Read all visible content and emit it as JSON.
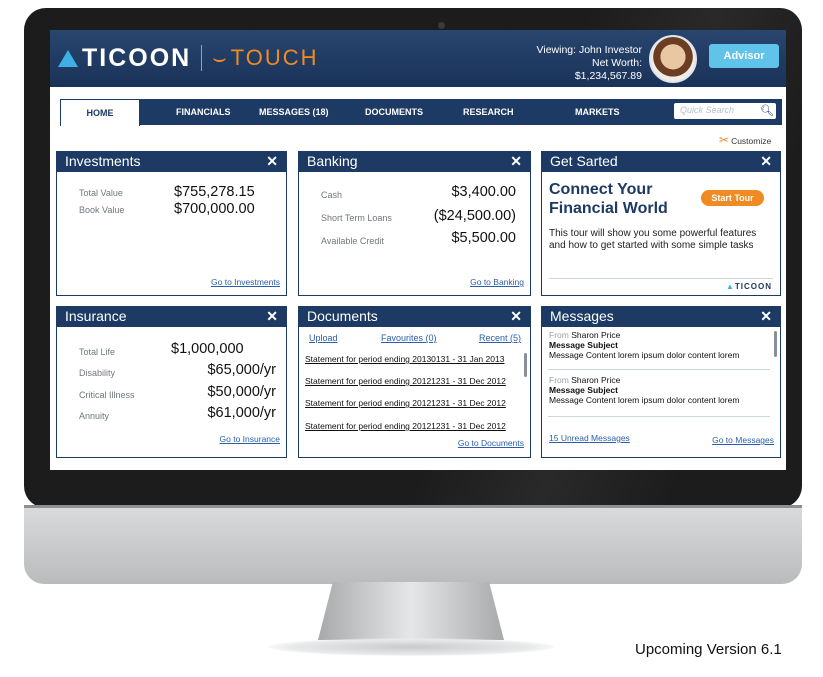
{
  "brand": {
    "logo_name": "TICOON",
    "logo_touch": "TOUCH"
  },
  "header": {
    "viewing": "Viewing: John Investor",
    "net_worth": "Net Worth: $1,234,567.89",
    "advisor_label": "Advisor"
  },
  "nav": {
    "items": [
      {
        "label": "HOME"
      },
      {
        "label": "FINANCIALS"
      },
      {
        "label": "MESSAGES (18)"
      },
      {
        "label": "DOCUMENTS"
      },
      {
        "label": "RESEARCH"
      },
      {
        "label": "MARKETS"
      }
    ],
    "active": "HOME",
    "search_placeholder": "Quick Search",
    "customize_label": "Customize"
  },
  "investments": {
    "title": "Investments",
    "rows": [
      {
        "label": "Total Value",
        "value": "$755,278.15"
      },
      {
        "label": "Book Value",
        "value": "$700,000.00"
      }
    ],
    "link": "Go to Investments"
  },
  "banking": {
    "title": "Banking",
    "rows": [
      {
        "label": "Cash",
        "value": "$3,400.00"
      },
      {
        "label": "Short Term Loans",
        "value": "($24,500.00)"
      },
      {
        "label": "Available Credit",
        "value": "$5,500.00"
      }
    ],
    "link": "Go to Banking"
  },
  "get_started": {
    "title": "Get Sarted",
    "heading_line1": "Connect Your",
    "heading_line2": "Financial World",
    "button": "Start Tour",
    "text": "This tour will show you some powerful features and how to get started with some simple tasks",
    "footer_logo": "TICOON"
  },
  "insurance": {
    "title": "Insurance",
    "rows": [
      {
        "label": "Total Life",
        "value": "$1,000,000"
      },
      {
        "label": "Disability",
        "value": "$65,000/yr"
      },
      {
        "label": "Critical Illness",
        "value": "$50,000/yr"
      },
      {
        "label": "Annuity",
        "value": "$61,000/yr"
      }
    ],
    "link": "Go to Insurance"
  },
  "documents": {
    "title": "Documents",
    "tabs": [
      "Upload",
      "Favourites (0)",
      "Recent (5)"
    ],
    "items": [
      "Statement for period ending 20130131 - 31 Jan 2013",
      "Statement for period ending 20121231 - 31 Dec 2012",
      "Statement for period ending 20121231 - 31 Dec 2012",
      "Statement for period ending 20121231 - 31 Dec 2012"
    ],
    "link": "Go to Documents"
  },
  "messages": {
    "title": "Messages",
    "items": [
      {
        "from_prefix": "From",
        "from": "Sharon Price",
        "subject": "Message Subject",
        "body": "Message Content lorem ipsum dolor content lorem"
      },
      {
        "from_prefix": "From",
        "from": "Sharon Price",
        "subject": "Message Subject",
        "body": "Message Content lorem ipsum dolor content lorem"
      }
    ],
    "unread_link": "15 Unread Messages",
    "link": "Go to Messages"
  },
  "caption": "Upcoming Version 6.1",
  "colors": {
    "navy": "#1c3a63",
    "accent_orange": "#f08a23",
    "advisor_blue": "#5fc3ea",
    "link_blue": "#2b5ea8"
  }
}
